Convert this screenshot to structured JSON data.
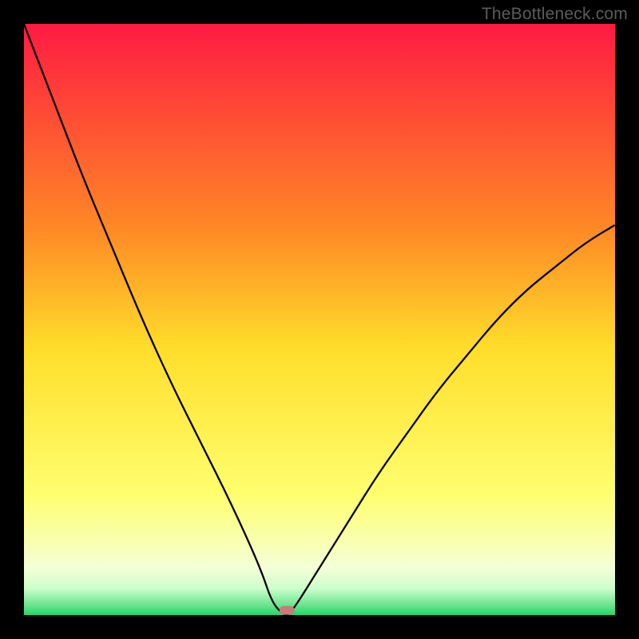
{
  "watermark": "TheBottleneck.com",
  "chart_data": {
    "type": "line",
    "title": "",
    "xlabel": "",
    "ylabel": "",
    "xlim": [
      0,
      100
    ],
    "ylim": [
      0,
      100
    ],
    "grid": false,
    "series": [
      {
        "name": "bottleneck-curve",
        "x": [
          0,
          5,
          10,
          15,
          20,
          25,
          30,
          35,
          40,
          42,
          44,
          45,
          50,
          55,
          60,
          65,
          70,
          75,
          80,
          85,
          90,
          95,
          100
        ],
        "values": [
          100,
          87,
          74,
          62,
          50,
          39,
          29,
          19,
          8,
          2,
          0,
          0,
          8,
          16,
          24,
          31,
          38,
          44,
          50,
          55,
          59,
          63,
          66
        ]
      }
    ],
    "marker": {
      "x": 44.5,
      "y": 0.8
    },
    "gradient_stops": [
      {
        "offset": 0,
        "color": "#ff1a42"
      },
      {
        "offset": 0.35,
        "color": "#ff8a25"
      },
      {
        "offset": 0.55,
        "color": "#ffde2b"
      },
      {
        "offset": 0.8,
        "color": "#ffff70"
      },
      {
        "offset": 0.92,
        "color": "#f4ffd6"
      },
      {
        "offset": 0.955,
        "color": "#ccffcc"
      },
      {
        "offset": 0.985,
        "color": "#66e28a"
      },
      {
        "offset": 1.0,
        "color": "#1fd867"
      }
    ],
    "curve_color": "#000000",
    "marker_color": "#c97a7a"
  }
}
